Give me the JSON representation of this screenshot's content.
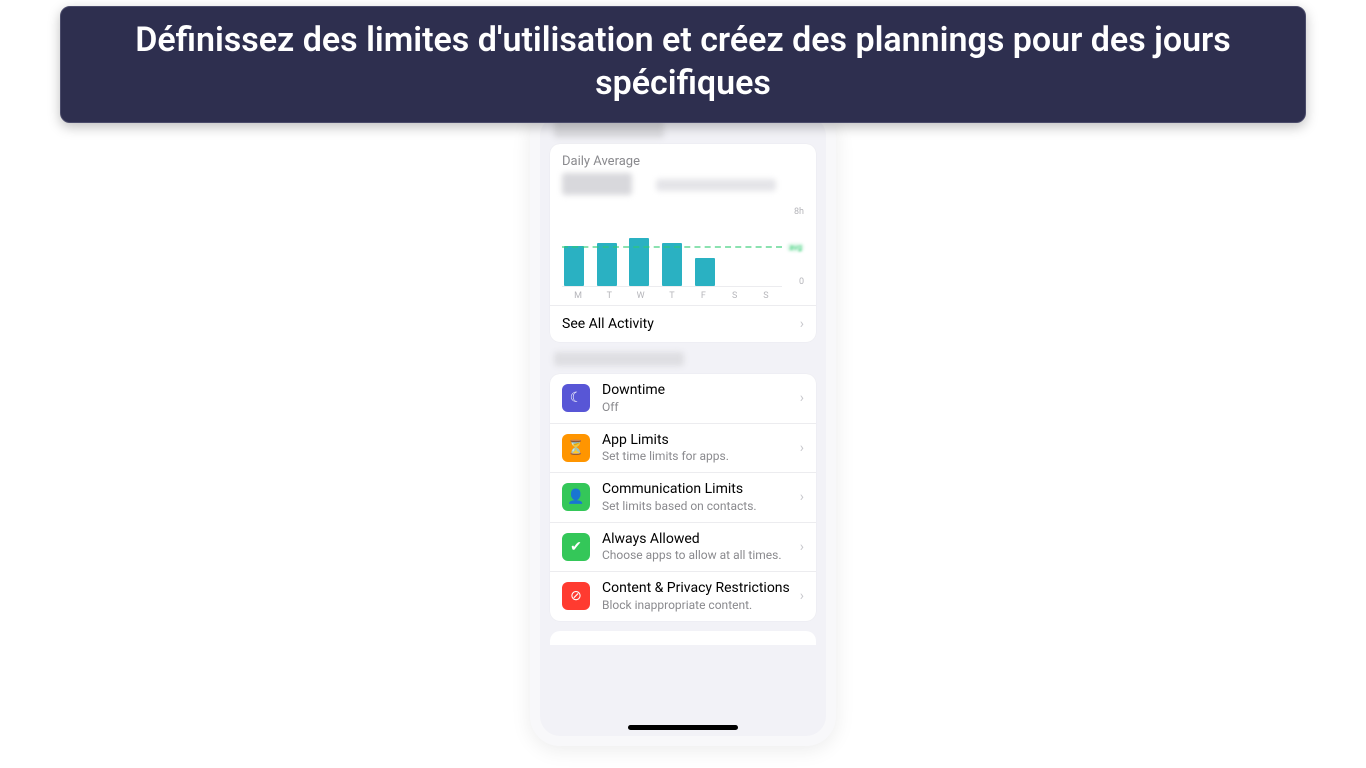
{
  "banner": {
    "text": "Définissez des limites d'utilisation et créez des plannings pour des jours spécifiques"
  },
  "chart_card": {
    "title": "Daily Average",
    "see_all": "See All Activity",
    "y_top": "8h",
    "y_bottom": "0",
    "avg_label": "avg"
  },
  "chart_data": {
    "type": "bar",
    "categories": [
      "M",
      "T",
      "W",
      "T",
      "F",
      "S",
      "S"
    ],
    "values": [
      4.0,
      4.3,
      4.8,
      4.3,
      2.8,
      0,
      0
    ],
    "ylim": [
      0,
      8
    ],
    "avg_line": 4.0,
    "xlabel": "",
    "ylabel": "",
    "title": "Daily Average"
  },
  "settings": [
    {
      "title": "Downtime",
      "sub": "Off",
      "icon_name": "moon-icon",
      "icon_class": "icon-purple",
      "glyph": "☾"
    },
    {
      "title": "App Limits",
      "sub": "Set time limits for apps.",
      "icon_name": "hourglass-icon",
      "icon_class": "icon-orange",
      "glyph": "⏳"
    },
    {
      "title": "Communication Limits",
      "sub": "Set limits based on contacts.",
      "icon_name": "contact-icon",
      "icon_class": "icon-green",
      "glyph": "👤"
    },
    {
      "title": "Always Allowed",
      "sub": "Choose apps to allow at all times.",
      "icon_name": "checkmark-icon",
      "icon_class": "icon-green",
      "glyph": "✔"
    },
    {
      "title": "Content & Privacy Restrictions",
      "sub": "Block inappropriate content.",
      "icon_name": "no-entry-icon",
      "icon_class": "icon-red",
      "glyph": "⊘"
    }
  ]
}
